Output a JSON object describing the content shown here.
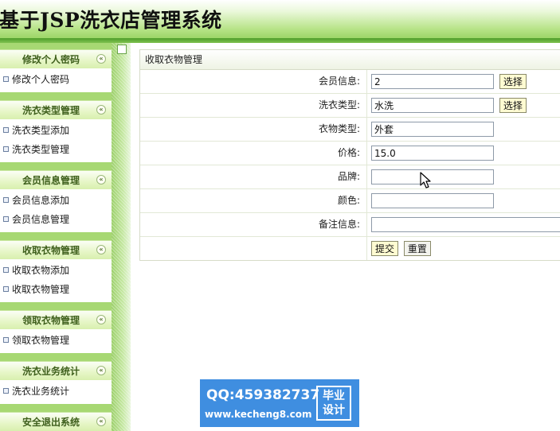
{
  "header": {
    "title": "基于JSP洗衣店管理系统"
  },
  "sidebar": {
    "groups": [
      {
        "title": "修改个人密码",
        "items": [
          "修改个人密码"
        ]
      },
      {
        "title": "洗衣类型管理",
        "items": [
          "洗衣类型添加",
          "洗衣类型管理"
        ]
      },
      {
        "title": "会员信息管理",
        "items": [
          "会员信息添加",
          "会员信息管理"
        ]
      },
      {
        "title": "收取衣物管理",
        "items": [
          "收取衣物添加",
          "收取衣物管理"
        ]
      },
      {
        "title": "领取衣物管理",
        "items": [
          "领取衣物管理"
        ]
      },
      {
        "title": "洗衣业务统计",
        "items": [
          "洗衣业务统计"
        ]
      },
      {
        "title": "安全退出系统",
        "items": []
      }
    ],
    "collapse_glyph": "«"
  },
  "form": {
    "title": "收取衣物管理",
    "fields": [
      {
        "label": "会员信息:",
        "value": "2",
        "button": "选择"
      },
      {
        "label": "洗衣类型:",
        "value": "水洗",
        "button": "选择"
      },
      {
        "label": "衣物类型:",
        "value": "外套"
      },
      {
        "label": "价格:",
        "value": "15.0"
      },
      {
        "label": "品牌:",
        "value": ""
      },
      {
        "label": "颜色:",
        "value": ""
      },
      {
        "label": "备注信息:",
        "value": ""
      }
    ],
    "submit_label": "提交",
    "reset_label": "重置"
  },
  "watermark": {
    "qq": "QQ:459382737",
    "site": "www.kecheng8.com",
    "badge_line1": "毕业",
    "badge_line2": "设计"
  },
  "colors": {
    "header_green": "#9cd567",
    "sidebar_green": "#a7d873",
    "button_yellow": "#fffbd2",
    "watermark_blue": "#3f8ee0"
  }
}
